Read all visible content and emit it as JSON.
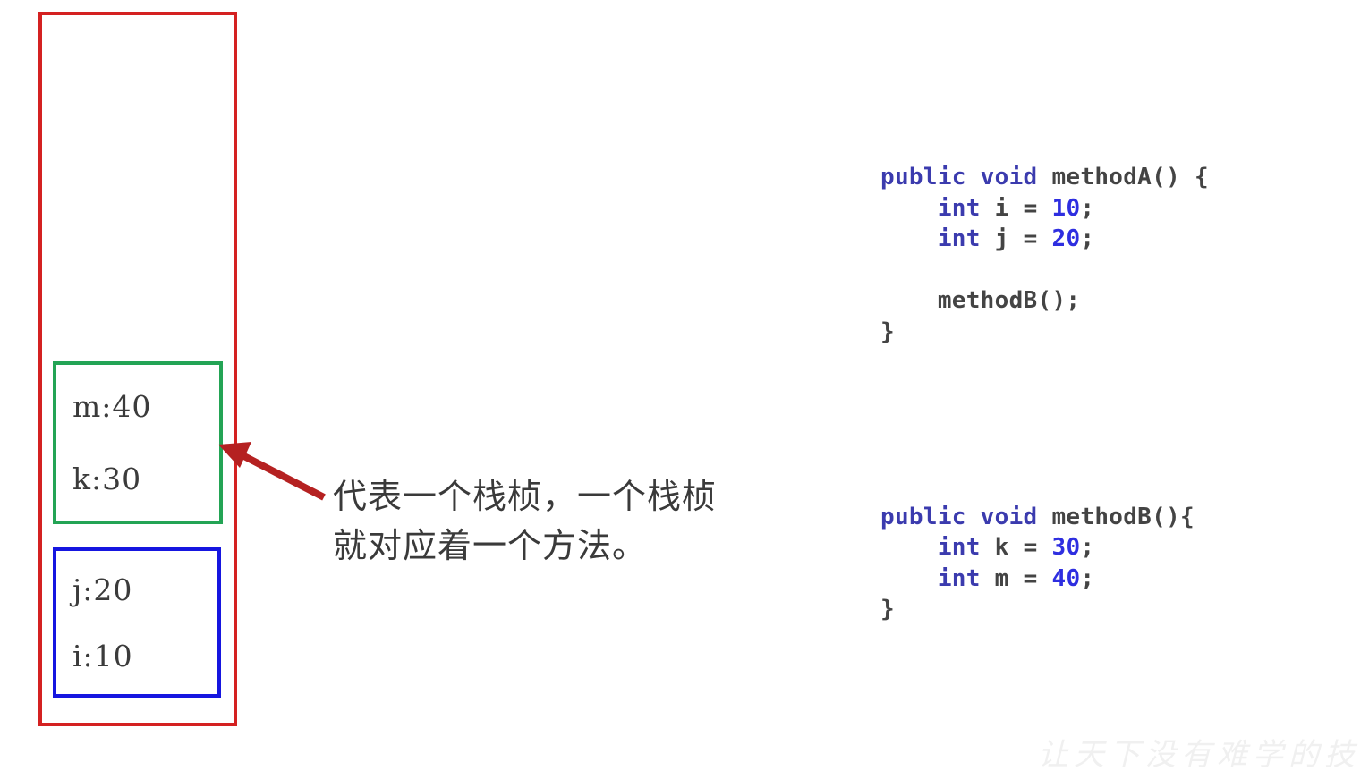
{
  "diagram": {
    "title": "JVM stack frame diagram",
    "colors": {
      "stack_border": "#d42121",
      "frame_b_border": "#23a455",
      "frame_a_border": "#1616e0",
      "arrow": "#b52121",
      "annotation_text": "#3a3a3a",
      "code_keyword": "#3b3bae",
      "code_number": "#2e2ee0",
      "code_plain": "#444444",
      "background": "#ffffff"
    },
    "stack": {
      "name": "stack-container",
      "frames": [
        {
          "name": "frame-methodB",
          "border_color": "#23a455",
          "rows": [
            "m:40",
            "k:30"
          ]
        },
        {
          "name": "frame-methodA",
          "border_color": "#1616e0",
          "rows": [
            "j:20",
            "i:10"
          ]
        }
      ]
    },
    "arrow": {
      "name": "callout-arrow",
      "color": "#b52121",
      "points_to": "frame-methodB"
    },
    "annotation": {
      "line1": "代表一个栈桢，一个栈桢",
      "line2": "就对应着一个方法。"
    },
    "watermark": "让天下没有难学的技"
  },
  "code": {
    "methodA": [
      [
        {
          "t": "public void ",
          "c": "kw"
        },
        {
          "t": "methodA() {",
          "c": "plain"
        }
      ],
      [
        {
          "t": "    ",
          "c": "plain"
        },
        {
          "t": "int",
          "c": "kw"
        },
        {
          "t": " i = ",
          "c": "plain"
        },
        {
          "t": "10",
          "c": "num"
        },
        {
          "t": ";",
          "c": "plain"
        }
      ],
      [
        {
          "t": "    ",
          "c": "plain"
        },
        {
          "t": "int",
          "c": "kw"
        },
        {
          "t": " j = ",
          "c": "plain"
        },
        {
          "t": "20",
          "c": "num"
        },
        {
          "t": ";",
          "c": "plain"
        }
      ],
      [],
      [
        {
          "t": "    methodB();",
          "c": "plain"
        }
      ],
      [
        {
          "t": "}",
          "c": "plain"
        }
      ]
    ],
    "methodB": [
      [
        {
          "t": "public void ",
          "c": "kw"
        },
        {
          "t": "methodB(){",
          "c": "plain"
        }
      ],
      [
        {
          "t": "    ",
          "c": "plain"
        },
        {
          "t": "int",
          "c": "kw"
        },
        {
          "t": " k = ",
          "c": "plain"
        },
        {
          "t": "30",
          "c": "num"
        },
        {
          "t": ";",
          "c": "plain"
        }
      ],
      [
        {
          "t": "    ",
          "c": "plain"
        },
        {
          "t": "int",
          "c": "kw"
        },
        {
          "t": " m = ",
          "c": "plain"
        },
        {
          "t": "40",
          "c": "num"
        },
        {
          "t": ";",
          "c": "plain"
        }
      ],
      [
        {
          "t": "}",
          "c": "plain"
        }
      ]
    ]
  }
}
